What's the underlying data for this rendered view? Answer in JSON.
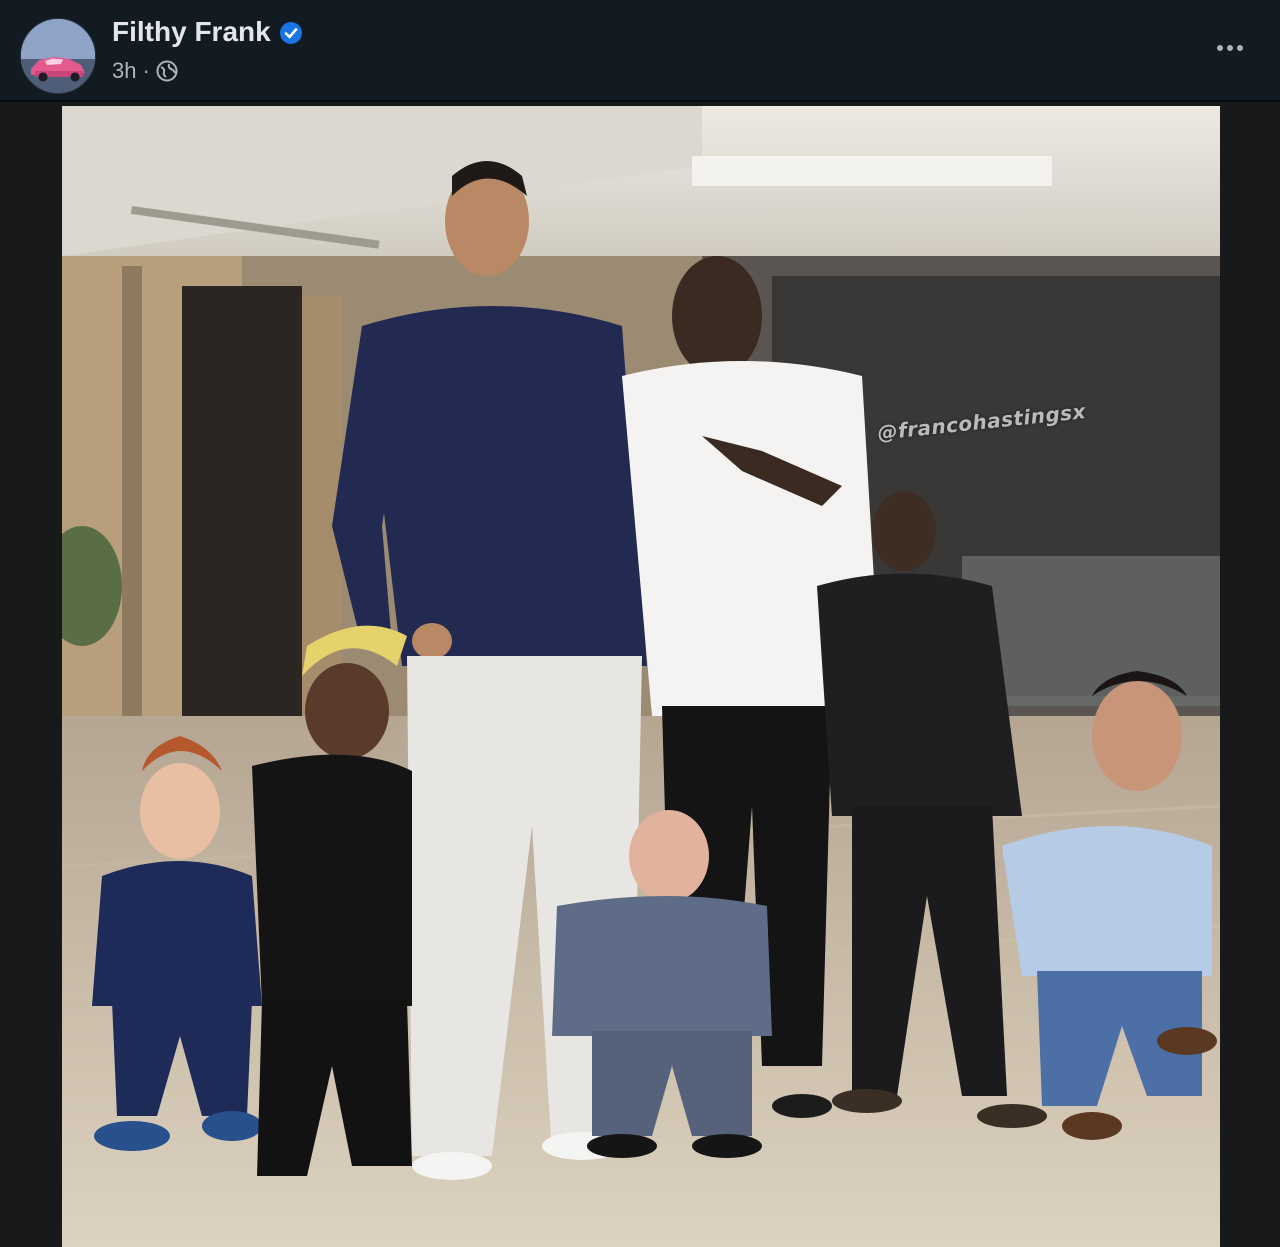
{
  "post": {
    "author": {
      "name": "Filthy Frank",
      "verified": true
    },
    "time": "3h",
    "separator": "·",
    "privacy_icon": "globe-icon",
    "more_icon": "more-horizontal-icon"
  },
  "photo": {
    "watermark": "@francohastingsx"
  },
  "colors": {
    "background": "#18191a",
    "header": "#121a22",
    "text_primary": "#e4e6eb",
    "text_secondary": "#b0b3b8",
    "verified": "#1b74e4"
  }
}
